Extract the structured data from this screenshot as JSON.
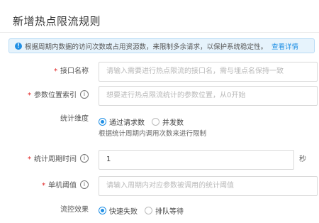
{
  "dialog": {
    "title": "新增热点限流规则",
    "info": {
      "text": "根据周期内数据的访问次数或占用资源数，来限制多余请求，以保护系统稳定性。",
      "link": "查看详情"
    }
  },
  "form": {
    "api_name": {
      "label": "接口名称",
      "placeholder": "请输入需要进行热点限流的接口名，需与埋点名保持一致"
    },
    "param_index": {
      "label": "参数位置索引",
      "placeholder": "想要进行热点限流统计的参数位置，从0开始"
    },
    "stat_dimension": {
      "label": "统计维度",
      "options": [
        "通过请求数",
        "并发数"
      ],
      "selected": "通过请求数",
      "hint": "根据统计周期内调用次数来进行限制"
    },
    "stat_period": {
      "label": "统计周期时间",
      "value": "1",
      "unit": "秒"
    },
    "threshold": {
      "label": "单机阈值",
      "placeholder": "请输入周期内对应参数被调用的统计阈值"
    },
    "control_effect": {
      "label": "流控效果",
      "options": [
        "快速失败",
        "排队等待"
      ],
      "selected": "快速失败"
    }
  },
  "icons": {
    "info": "info-circle-icon",
    "help": "question-circle-icon"
  },
  "colors": {
    "accent": "#1f8fe5",
    "required": "#e02020",
    "info_bg": "#e6f3fc"
  }
}
